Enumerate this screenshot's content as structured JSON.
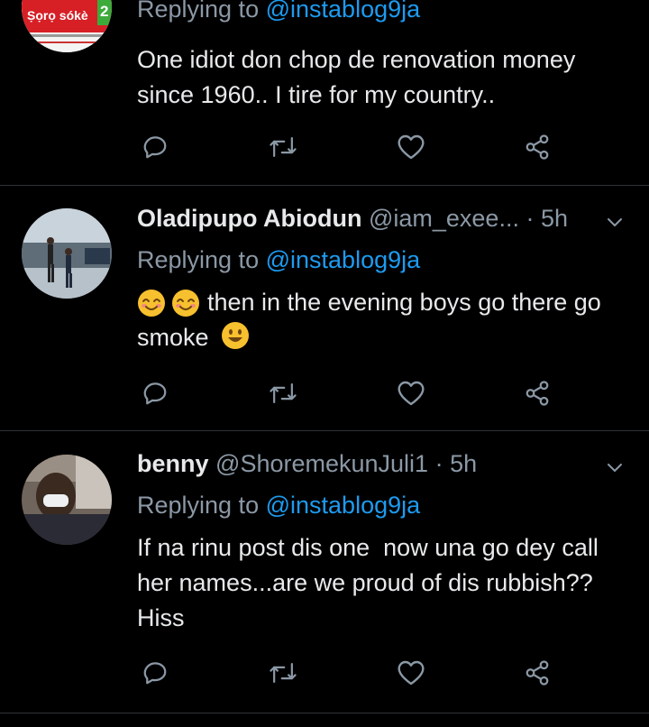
{
  "tweets": [
    {
      "reply_prefix": "Replying to",
      "reply_mention": "@instablog9ja",
      "text": "One idiot don chop de renovation money since 1960.. I tire for my country..",
      "avatar": {
        "badge_text": "Ṣọrọ sókè",
        "badge_number": "2"
      }
    },
    {
      "name": "Oladipupo Abiodun",
      "handle": "@iam_exee...",
      "dot": "·",
      "time": "5h",
      "reply_prefix": "Replying to",
      "reply_mention": "@instablog9ja",
      "text": "then in the evening boys go there go smoke"
    },
    {
      "name": "benny",
      "handle": "@ShoremekunJuli1",
      "dot": "·",
      "time": "5h",
      "reply_prefix": "Replying to",
      "reply_mention": "@instablog9ja",
      "text": "If na rinu post dis one  now una go dey call her names...are we proud of dis rubbish?? Hiss"
    }
  ],
  "icons": {
    "reply": "reply-icon",
    "retweet": "retweet-icon",
    "like": "heart-icon",
    "share": "share-icon",
    "more": "chevron-down-icon"
  },
  "colors": {
    "background": "#000000",
    "text": "#e7e9ea",
    "muted": "#8b98a5",
    "link": "#1d9bf0",
    "divider": "#2f3336"
  }
}
